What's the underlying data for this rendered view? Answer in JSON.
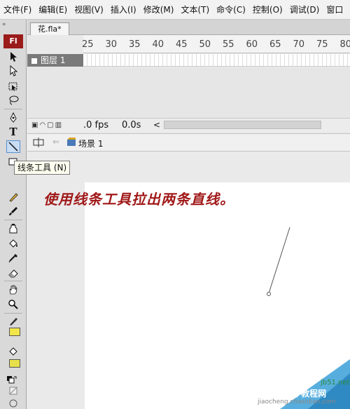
{
  "menu": [
    "文件(F)",
    "编辑(E)",
    "视图(V)",
    "插入(I)",
    "修改(M)",
    "文本(T)",
    "命令(C)",
    "控制(O)",
    "调试(D)",
    "窗口"
  ],
  "tools_panel": {
    "collapse": "»",
    "logo": "Fl",
    "tool_icons": [
      "selection-arrow-icon",
      "subselection-arrow-icon",
      "free-transform-icon",
      "lasso-icon",
      "pen-icon",
      "text-icon",
      "line-icon",
      "rectangle-icon",
      "pencil-icon",
      "brush-icon",
      "ink-bottle-icon",
      "paint-bucket-icon",
      "eyedropper-icon",
      "eraser-icon",
      "hand-icon",
      "zoom-icon",
      "stroke-color-icon",
      "fill-color-icon",
      "black-white-icon",
      "swap-colors-icon",
      "snap-icon"
    ],
    "text_tool_glyph": "T",
    "stroke_color": "#f2e64b",
    "fill_color": "#e8e04a"
  },
  "document": {
    "tab_label": "花.fla*"
  },
  "timeline": {
    "ruler_numbers": [
      "25",
      "30",
      "35",
      "40",
      "45",
      "50",
      "55",
      "60",
      "65",
      "70",
      "75",
      "80"
    ],
    "layer_name": "图层 1",
    "fps": ".0 fps",
    "time": "0.0s",
    "scroll_arrow": "<"
  },
  "edit_bar": {
    "scene": "场景 1"
  },
  "tooltip": "线条工具 (N)",
  "stage": {
    "instruction": "使用线条工具拉出两条直线。",
    "background": "#ffffff",
    "line_color": "#555555"
  },
  "watermark": {
    "site": "jb51.net",
    "badge": "查字典 教程网",
    "url": "jiaocheng.chazidian.com"
  }
}
